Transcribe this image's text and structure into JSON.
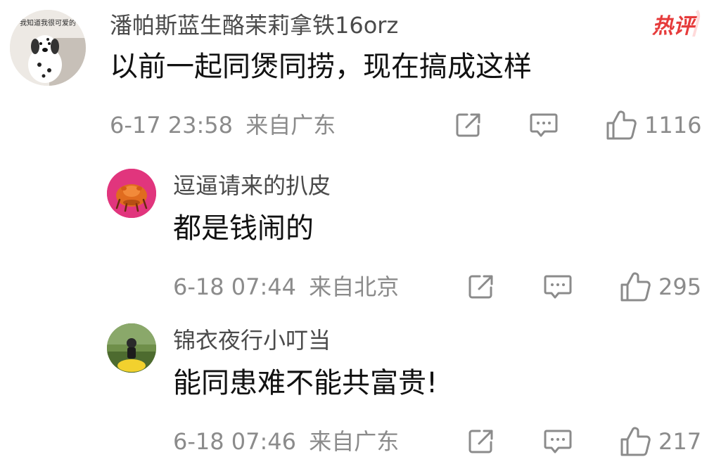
{
  "hot_badge": "热评",
  "comments": [
    {
      "username": "潘帕斯蓝生酪茉莉拿铁16orz",
      "content": "以前一起同煲同捞，现在搞成这样",
      "timestamp": "6-17 23:58",
      "location": "来自广东",
      "likes": "1116",
      "avatar_text": "我知道我很可爱的"
    },
    {
      "username": "逗逼请来的扒皮",
      "content": "都是钱闹的",
      "timestamp": "6-18 07:44",
      "location": "来自北京",
      "likes": "295"
    },
    {
      "username": "锦衣夜行小叮当",
      "content": "能同患难不能共富贵!",
      "timestamp": "6-18 07:46",
      "location": "来自广东",
      "likes": "217"
    }
  ]
}
